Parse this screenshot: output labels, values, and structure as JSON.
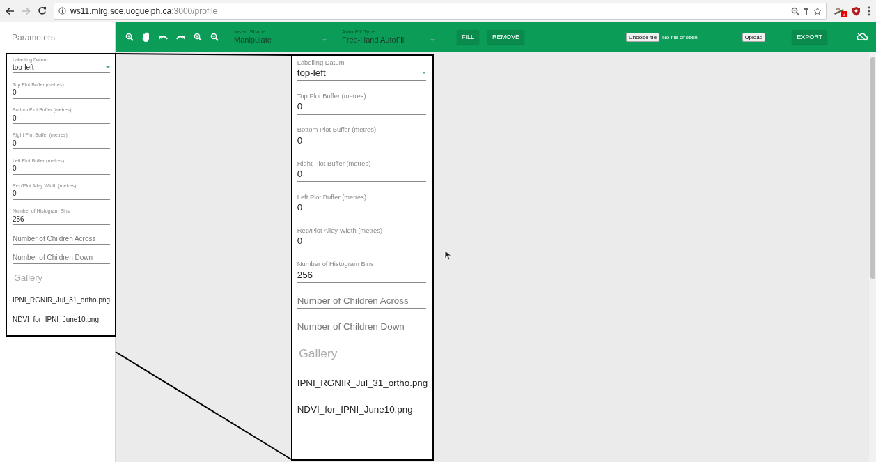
{
  "browser": {
    "url_host": "ws11.mlrg.soe.uoguelph.ca",
    "url_path": ":3000/profile",
    "extension_badge": "2"
  },
  "sidebar": {
    "title": "Parameters"
  },
  "toolbar": {
    "dropdowns": [
      {
        "label": "Insert Shape",
        "value": "Manipulate"
      },
      {
        "label": "Auto Fill Type",
        "value": "Free-Hand AutoFill"
      }
    ],
    "buttons": [
      "FILL",
      "REMOVE"
    ],
    "file_input": {
      "button": "Choose file",
      "status": "No file chosen"
    },
    "upload": "Upload",
    "export": "EXPORT"
  },
  "parameters_panel": {
    "fields": [
      {
        "kind": "select",
        "label": "Labelling Datum",
        "value": "top-left"
      },
      {
        "kind": "input",
        "label": "Top Plot Buffer (metres)",
        "value": "0"
      },
      {
        "kind": "input",
        "label": "Bottom Plot Buffer (metres)",
        "value": "0"
      },
      {
        "kind": "input",
        "label": "Right Plot Buffer (metres)",
        "value": "0"
      },
      {
        "kind": "input",
        "label": "Left Plot Buffer (metres)",
        "value": "0"
      },
      {
        "kind": "input",
        "label": "Rep/Plot Alley Width (metres)",
        "value": "0"
      },
      {
        "kind": "input",
        "label": "Number of Histogram Bins",
        "value": "256"
      },
      {
        "kind": "empty",
        "placeholder": "Number of Children Across"
      },
      {
        "kind": "empty",
        "placeholder": "Number of Children Down"
      }
    ],
    "gallery_title": "Gallery",
    "gallery": [
      "IPNI_RGNIR_Jul_31_ortho.png",
      "NDVI_for_IPNI_June10.png"
    ]
  },
  "magnified_panel": {
    "fields": [
      {
        "kind": "select",
        "label": "Labelling Datum",
        "value": "top-left"
      },
      {
        "kind": "input",
        "label": "Top Plot Buffer (metres)",
        "value": "0"
      },
      {
        "kind": "input",
        "label": "Bottom Plot Buffer (metres)",
        "value": "0"
      },
      {
        "kind": "input",
        "label": "Right Plot Buffer (metres)",
        "value": "0"
      },
      {
        "kind": "input",
        "label": "Left Plot Buffer (metres)",
        "value": "0"
      },
      {
        "kind": "input",
        "label": "Rep/Plot Alley Width (metres)",
        "value": "0"
      },
      {
        "kind": "input",
        "label": "Number of Histogram Bins",
        "value": "256"
      },
      {
        "kind": "empty",
        "placeholder": "Number of Children Across"
      },
      {
        "kind": "empty",
        "placeholder": "Number of Children Down"
      }
    ],
    "gallery_title": "Gallery",
    "gallery": [
      "IPNI_RGNIR_Jul_31_ortho.png",
      "NDVI_for_IPNI_June10.png"
    ]
  }
}
